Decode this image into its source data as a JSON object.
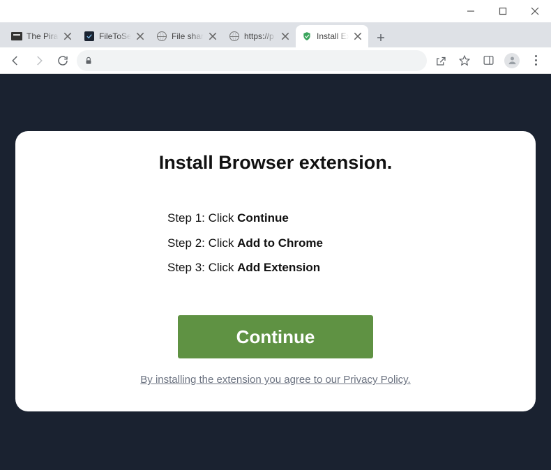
{
  "window": {
    "tabs": [
      {
        "label": "The Pirate",
        "favicon": "black"
      },
      {
        "label": "FileToSend",
        "favicon": "dark"
      },
      {
        "label": "File sharing",
        "favicon": "globe"
      },
      {
        "label": "https://p",
        "favicon": "globe"
      },
      {
        "label": "Install Ext",
        "favicon": "shield",
        "active": true
      }
    ]
  },
  "page": {
    "heading": "Install Browser extension.",
    "steps": [
      {
        "prefix": "Step 1: Click ",
        "bold": "Continue"
      },
      {
        "prefix": "Step 2: Click ",
        "bold": "Add to Chrome"
      },
      {
        "prefix": "Step 3: Click ",
        "bold": "Add Extension"
      }
    ],
    "cta": "Continue",
    "policy": "By installing the extension you agree to our Privacy Policy."
  }
}
